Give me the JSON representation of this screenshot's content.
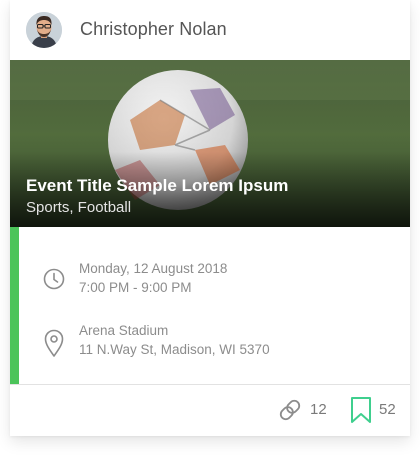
{
  "author": {
    "name": "Christopher Nolan"
  },
  "event": {
    "title": "Event Title Sample Lorem Ipsum",
    "category": "Sports, Football"
  },
  "schedule": {
    "date": "Monday, 12 August 2018",
    "time": "7:00 PM - 9:00 PM",
    "icon": "clock-icon"
  },
  "venue": {
    "name": "Arena Stadium",
    "address": "11 N.Way St, Madison, WI 5370",
    "icon": "location-pin-icon"
  },
  "actions": {
    "link_count": "12",
    "bookmark_count": "52"
  },
  "colors": {
    "accent": "#4cc45a",
    "bookmark": "#3fcf8e"
  }
}
